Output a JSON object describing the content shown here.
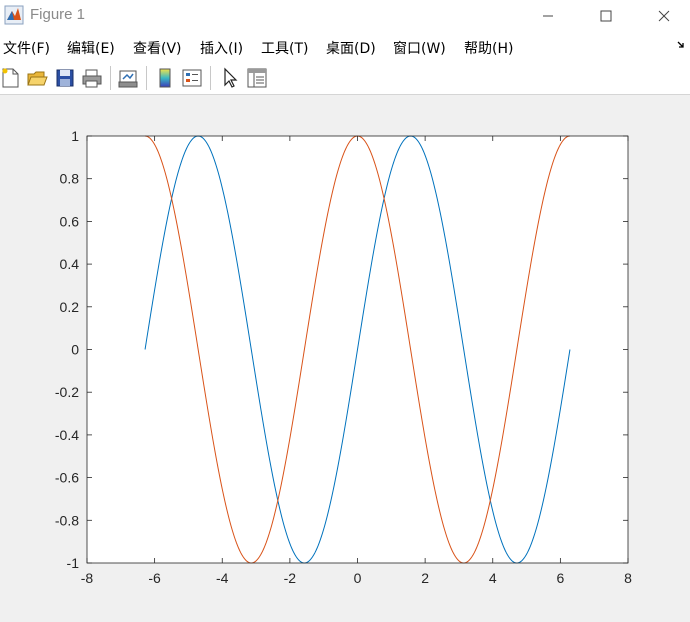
{
  "window": {
    "title": "Figure 1",
    "icon": "matlab-logo-icon",
    "controls": [
      "minimize-icon",
      "maximize-icon",
      "close-icon"
    ]
  },
  "menubar": {
    "items": [
      {
        "label": "文件(F)"
      },
      {
        "label": "编辑(E)"
      },
      {
        "label": "查看(V)"
      },
      {
        "label": "插入(I)"
      },
      {
        "label": "工具(T)"
      },
      {
        "label": "桌面(D)"
      },
      {
        "label": "窗口(W)"
      },
      {
        "label": "帮助(H)"
      }
    ],
    "overflow_icon": "dock-arrow-icon"
  },
  "toolbar": {
    "tools": [
      "new-figure-icon",
      "open-file-icon",
      "save-icon",
      "print-icon",
      "link-plot-icon",
      "insert-colorbar-icon",
      "insert-legend-icon",
      "edit-plot-icon",
      "property-inspector-icon"
    ]
  },
  "chart_data": {
    "type": "line",
    "title": "",
    "xlabel": "",
    "ylabel": "",
    "xlim": [
      -8,
      8
    ],
    "ylim": [
      -1,
      1
    ],
    "x_domain": [
      -6.2832,
      6.2832
    ],
    "xticks": [
      -8,
      -6,
      -4,
      -2,
      0,
      2,
      4,
      6,
      8
    ],
    "yticks": [
      -1,
      -0.8,
      -0.6,
      -0.4,
      -0.2,
      0,
      0.2,
      0.4,
      0.6,
      0.8,
      1
    ],
    "grid": false,
    "legend": "none",
    "series": [
      {
        "function": "sin",
        "color": "#0072bd"
      },
      {
        "function": "cos",
        "color": "#d95319"
      }
    ],
    "axis_color": "#262626",
    "background": "#ffffff"
  }
}
